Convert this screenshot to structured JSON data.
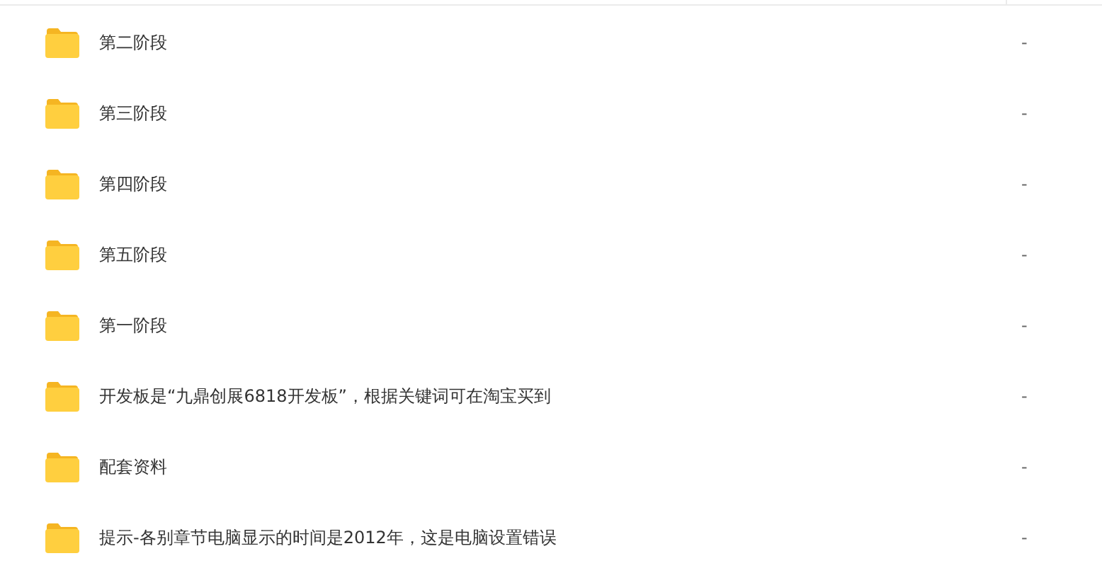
{
  "files": [
    {
      "name": "第二阶段",
      "size": "-"
    },
    {
      "name": "第三阶段",
      "size": "-"
    },
    {
      "name": "第四阶段",
      "size": "-"
    },
    {
      "name": "第五阶段",
      "size": "-"
    },
    {
      "name": "第一阶段",
      "size": "-"
    },
    {
      "name": "开发板是“九鼎创展6818开发板”，根据关键词可在淘宝买到",
      "size": "-"
    },
    {
      "name": "配套资料",
      "size": "-"
    },
    {
      "name": "提示-各别章节电脑显示的时间是2012年，这是电脑设置错误",
      "size": "-"
    }
  ]
}
